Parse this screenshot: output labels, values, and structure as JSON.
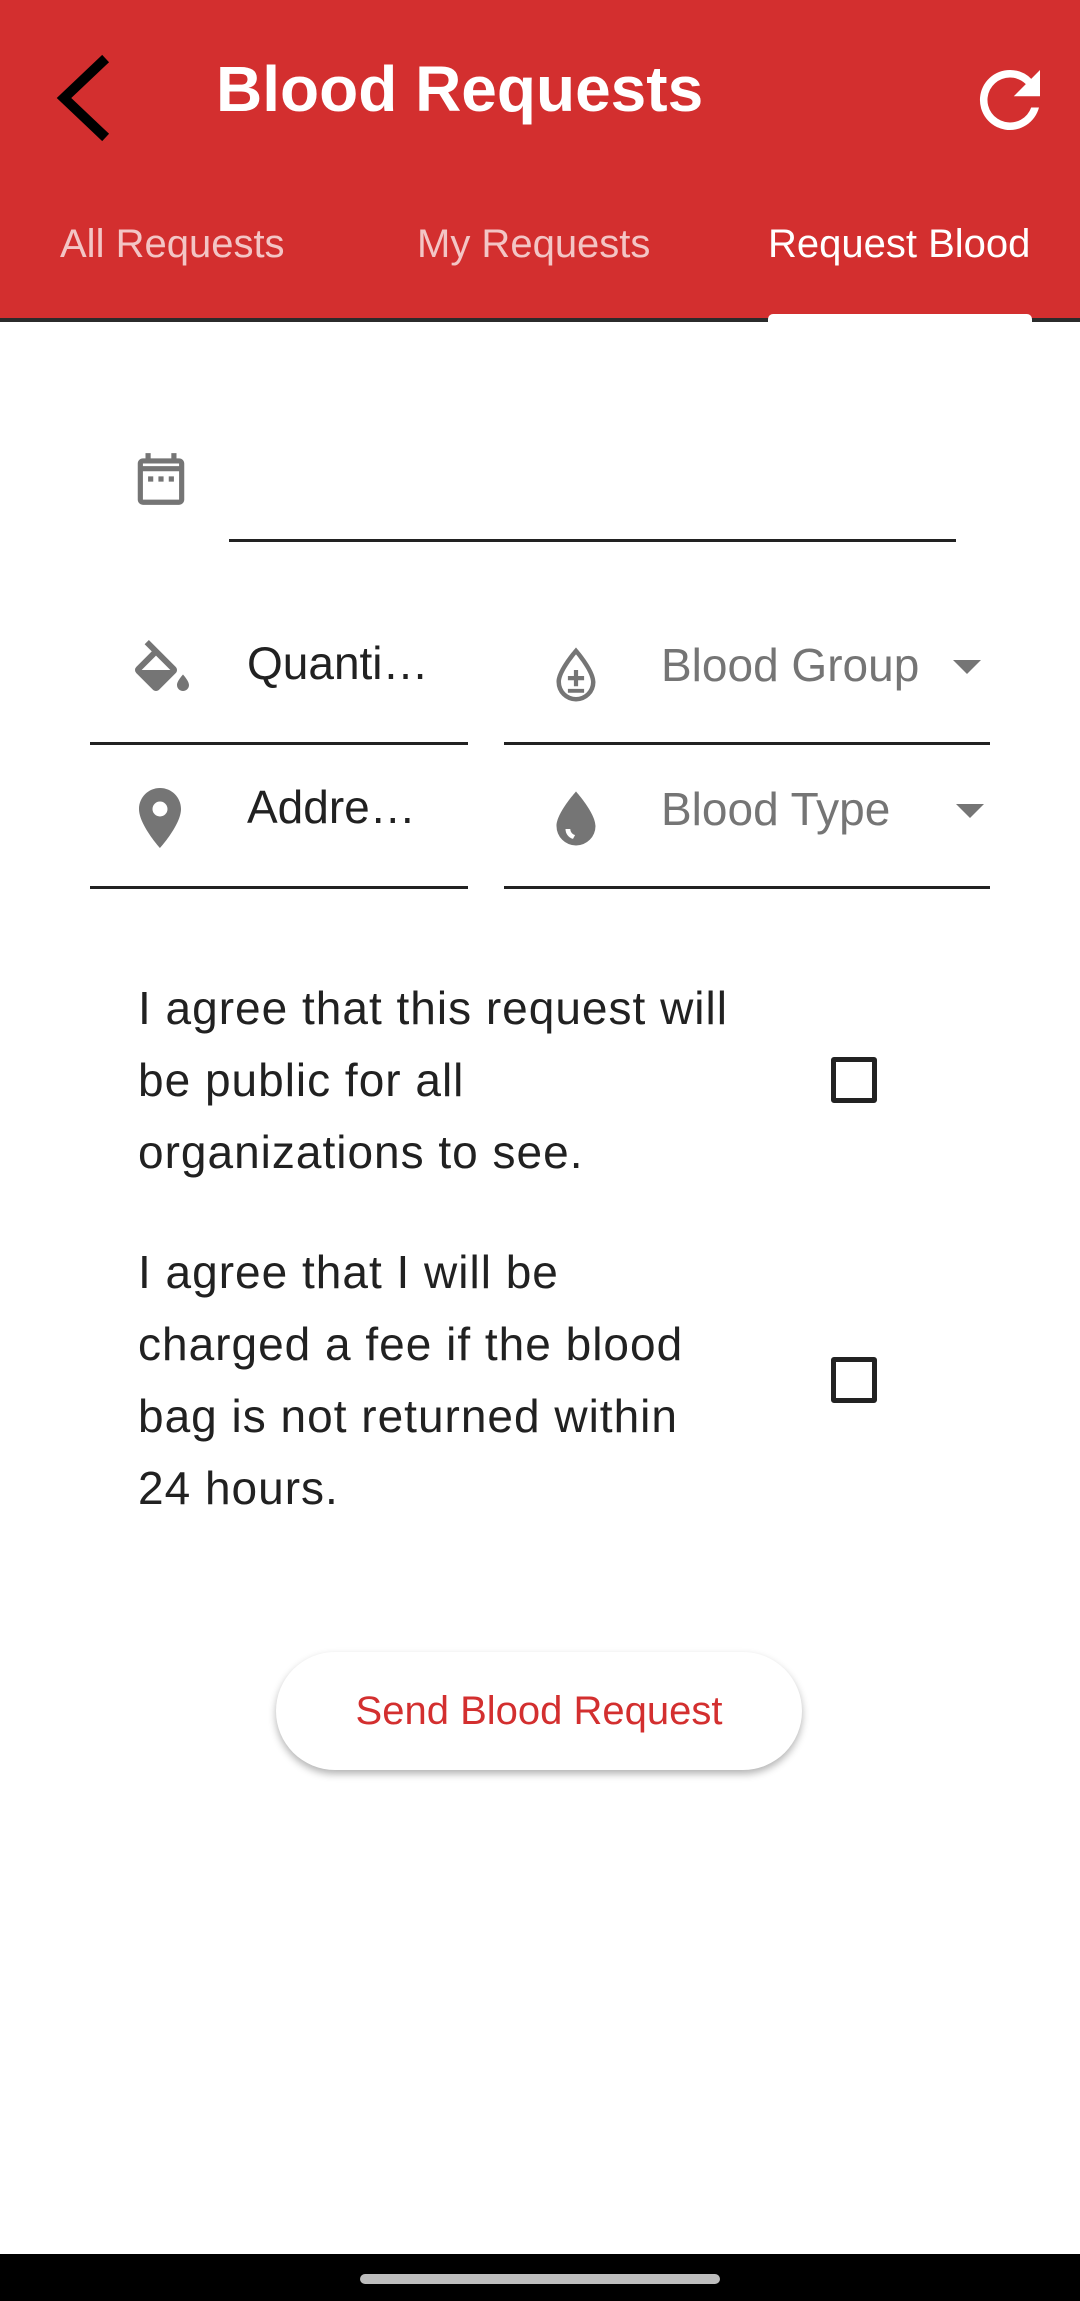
{
  "appbar": {
    "title": "Blood Requests",
    "back_icon": "back-arrow-icon",
    "refresh_icon": "refresh-icon",
    "color": "#d32f2f"
  },
  "tabs": [
    {
      "label": "All Requests",
      "active": false
    },
    {
      "label": "My Requests",
      "active": false
    },
    {
      "label": "Request Blood",
      "active": true
    }
  ],
  "form": {
    "date": {
      "icon": "calendar-icon",
      "value": ""
    },
    "quantity": {
      "icon": "paint-bucket-icon",
      "placeholder": "Quanti…"
    },
    "blood_group": {
      "icon": "blood-drop-plus-minus-icon",
      "placeholder": "Blood Group"
    },
    "address": {
      "icon": "location-pin-icon",
      "placeholder": "Addre…"
    },
    "blood_type": {
      "icon": "blood-drop-icon",
      "placeholder": "Blood Type"
    }
  },
  "consents": [
    {
      "text": "I agree that this request will be public for all organizations to see.",
      "checked": false
    },
    {
      "text": "I agree that I will be charged a fee if the blood bag is not returned within 24 hours.",
      "checked": false
    }
  ],
  "send_button": {
    "label": "Send Blood Request",
    "color": "#d32f2f"
  }
}
